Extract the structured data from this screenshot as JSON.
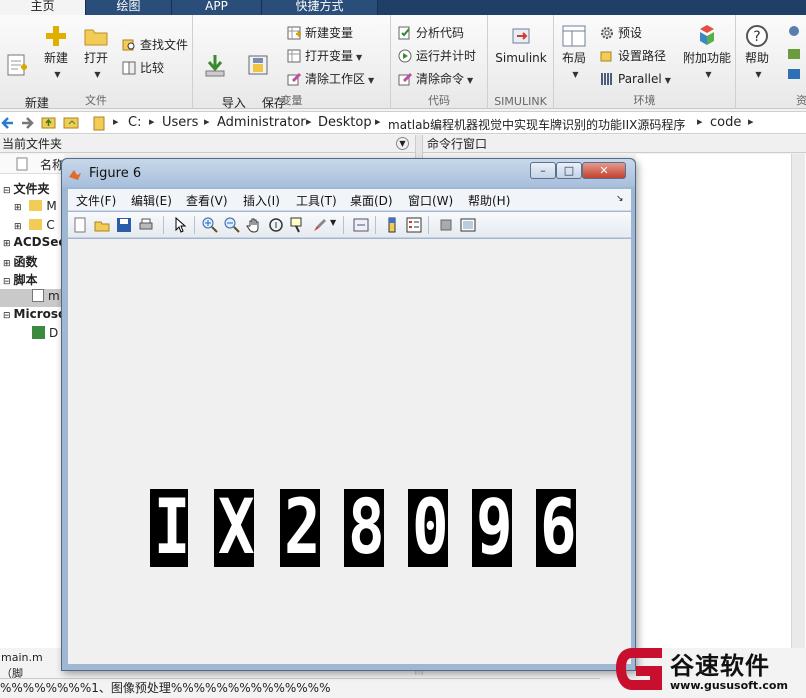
{
  "ribbon_tabs": [
    "主页",
    "绘图",
    "APP",
    "快捷方式"
  ],
  "groups": {
    "file": {
      "label": "文件",
      "new_script": "新建\n脚本",
      "new": "新建",
      "open": "打开",
      "find_files": "查找文件",
      "compare": "比较"
    },
    "variable": {
      "label": "变量",
      "import_data": "导入\n数据",
      "save_workspace": "保存\n工作区",
      "new_variable": "新建变量",
      "open_variable": "打开变量",
      "clear_workspace": "清除工作区"
    },
    "code": {
      "label": "代码",
      "analyze_code": "分析代码",
      "run_and_time": "运行并计时",
      "clear_commands": "清除命令"
    },
    "simulink": {
      "label": "SIMULINK",
      "button": "Simulink"
    },
    "environment": {
      "label": "环境",
      "layout": "布局",
      "preferences": "预设",
      "set_path": "设置路径",
      "parallel": "Parallel",
      "addons": "附加功能"
    },
    "resources": {
      "label": "资",
      "help": "帮助"
    }
  },
  "address": {
    "crumbs": [
      "C:",
      "Users",
      "Administrator",
      "Desktop",
      "matlab编程机器视觉中实现车牌识别的功能IIX源码程序",
      "code"
    ]
  },
  "current_folder": {
    "header": "当前文件夹",
    "col_name": "名称",
    "tree": [
      {
        "label": "文件夹",
        "bold": true
      },
      {
        "label": "M",
        "bold": false
      },
      {
        "label": "C",
        "bold": false
      },
      {
        "label": "ACDSee",
        "bold": true
      },
      {
        "label": "函数",
        "bold": true
      },
      {
        "label": "脚本",
        "bold": true
      },
      {
        "label": "m",
        "bold": false
      },
      {
        "label": "Microso",
        "bold": true
      },
      {
        "label": "D",
        "bold": false
      }
    ],
    "status_file": "main.m（脚"
  },
  "command_window": {
    "header": "命令行窗口"
  },
  "script_line": "%%%%%%%%1、图像预处理%%%%%%%%%%%%%%",
  "figure": {
    "title": "Figure 6",
    "menu": [
      "文件(F)",
      "编辑(E)",
      "查看(V)",
      "插入(I)",
      "工具(T)",
      "桌面(D)",
      "窗口(W)",
      "帮助(H)"
    ],
    "window_buttons": {
      "minimize": "–",
      "maximize": "□",
      "close": "✕"
    },
    "plate_chars": [
      "I",
      "X",
      "2",
      "8",
      "0",
      "9",
      "6"
    ]
  },
  "watermark": {
    "text": "谷速软件",
    "url": "www.gususoft.com"
  },
  "colors": {
    "ribbon_dark": "#1f3f66",
    "ribbon_tab_active": "#f4f4f4",
    "figure_frame": "#9fb7d2",
    "watermark_red": "#c8102e"
  }
}
